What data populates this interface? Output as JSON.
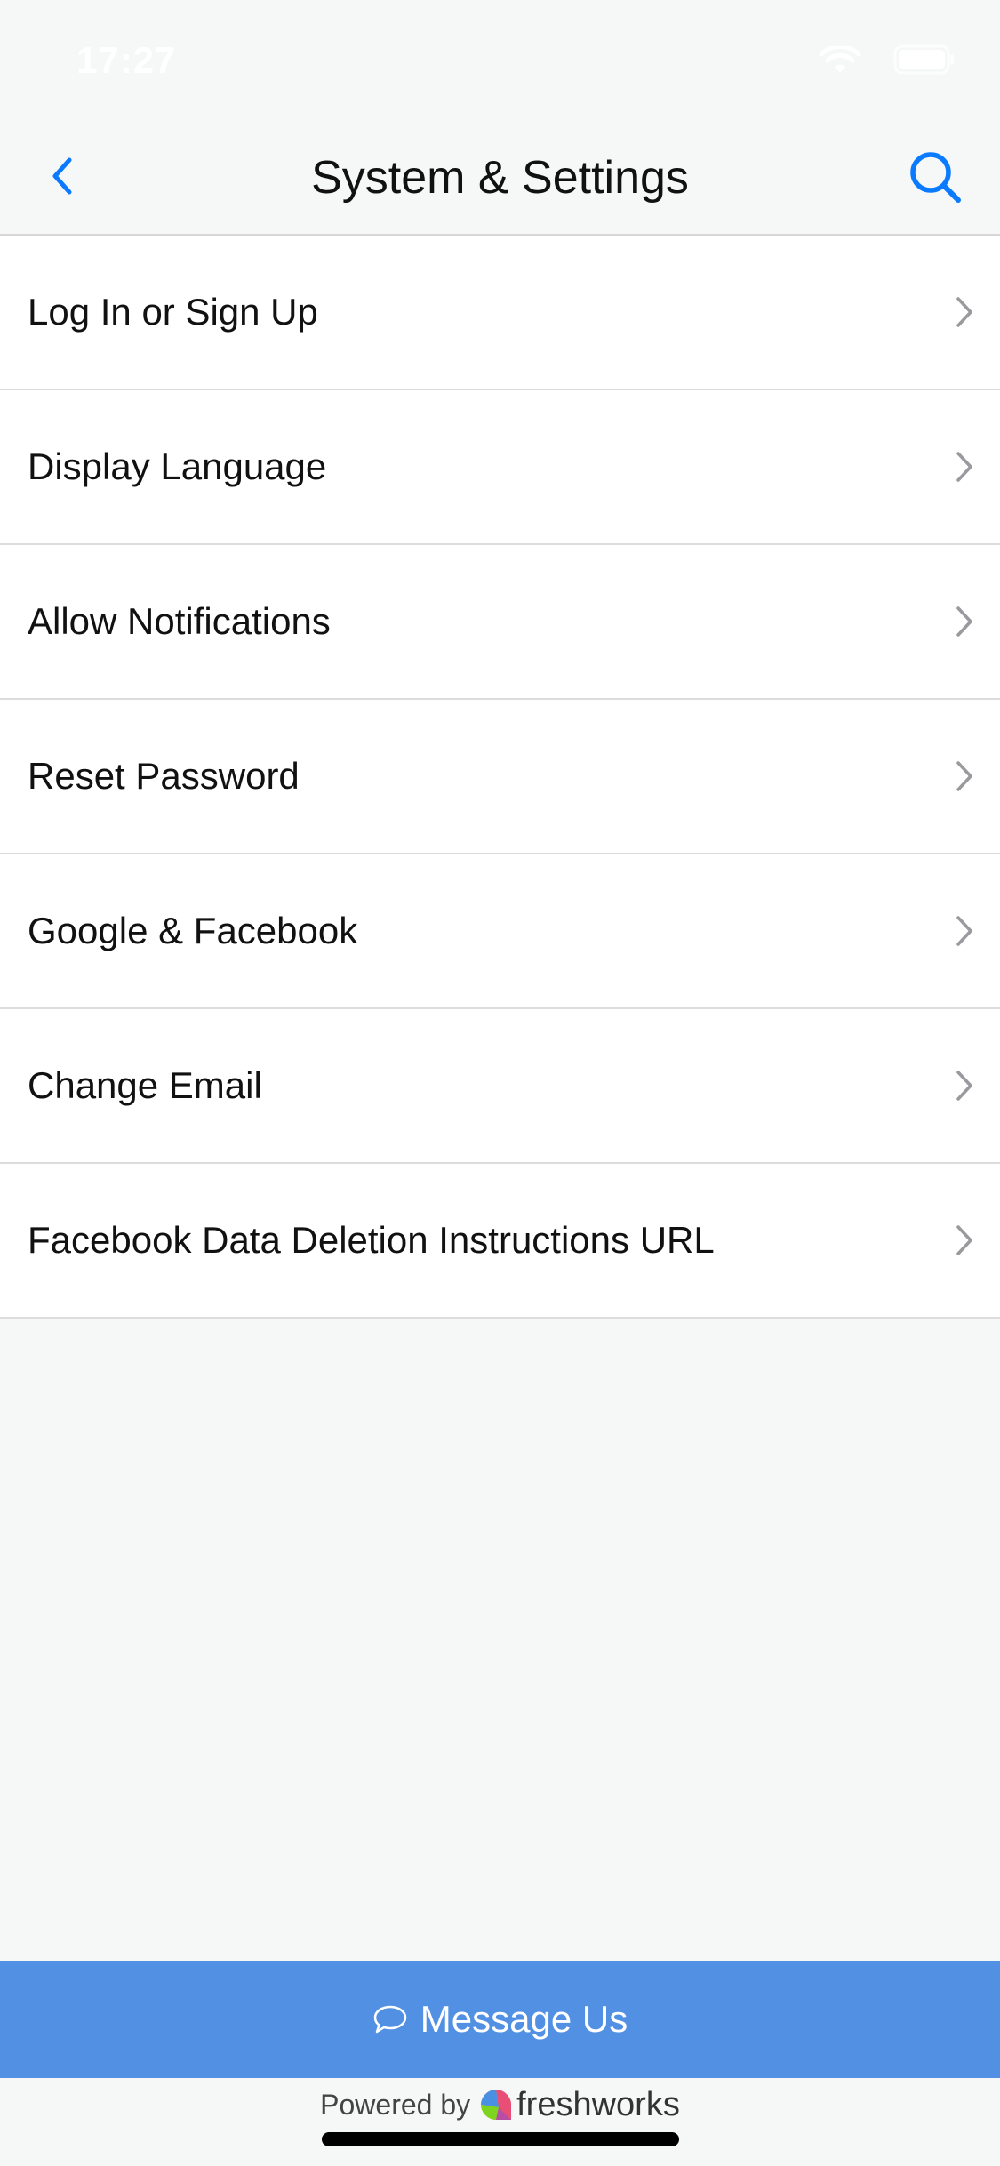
{
  "status_bar": {
    "time": "17:27"
  },
  "nav": {
    "title": "System & Settings",
    "back_icon": "chevron-left-icon",
    "search_icon": "search-icon",
    "accent_color": "#0a7aff"
  },
  "settings": {
    "items": [
      {
        "label": "Log In or Sign Up"
      },
      {
        "label": "Display Language"
      },
      {
        "label": "Allow Notifications"
      },
      {
        "label": "Reset Password"
      },
      {
        "label": "Google & Facebook"
      },
      {
        "label": "Change Email"
      },
      {
        "label": "Facebook Data Deletion Instructions URL"
      }
    ]
  },
  "message_button": {
    "label": "Message Us",
    "icon": "chat-bubble-icon",
    "color": "#5190e3"
  },
  "footer": {
    "powered_by": "Powered by",
    "brand": "freshworks"
  }
}
